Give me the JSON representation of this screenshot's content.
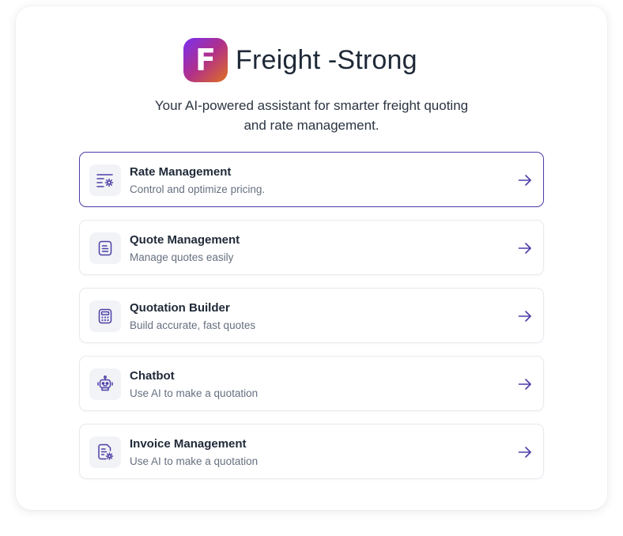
{
  "brand": {
    "logo_letter": "F",
    "name": "Freight -Strong"
  },
  "tagline": {
    "line1": "Your AI-powered assistant for smarter freight quoting",
    "line2": "and rate management."
  },
  "colors": {
    "accent": "#4c3fa8",
    "title_text": "#1f2937",
    "subtitle_text": "#667080"
  },
  "menu": [
    {
      "title": "Rate Management",
      "subtitle": "Control and optimize pricing.",
      "icon": "rate-settings-icon",
      "selected": true
    },
    {
      "title": "Quote Management",
      "subtitle": "Manage quotes easily",
      "icon": "document-icon",
      "selected": false
    },
    {
      "title": "Quotation Builder",
      "subtitle": "Build accurate, fast quotes",
      "icon": "calculator-icon",
      "selected": false
    },
    {
      "title": "Chatbot",
      "subtitle": "Use AI to make a quotation",
      "icon": "robot-icon",
      "selected": false
    },
    {
      "title": "Invoice Management",
      "subtitle": "Use AI to make a quotation",
      "icon": "invoice-settings-icon",
      "selected": false
    }
  ]
}
